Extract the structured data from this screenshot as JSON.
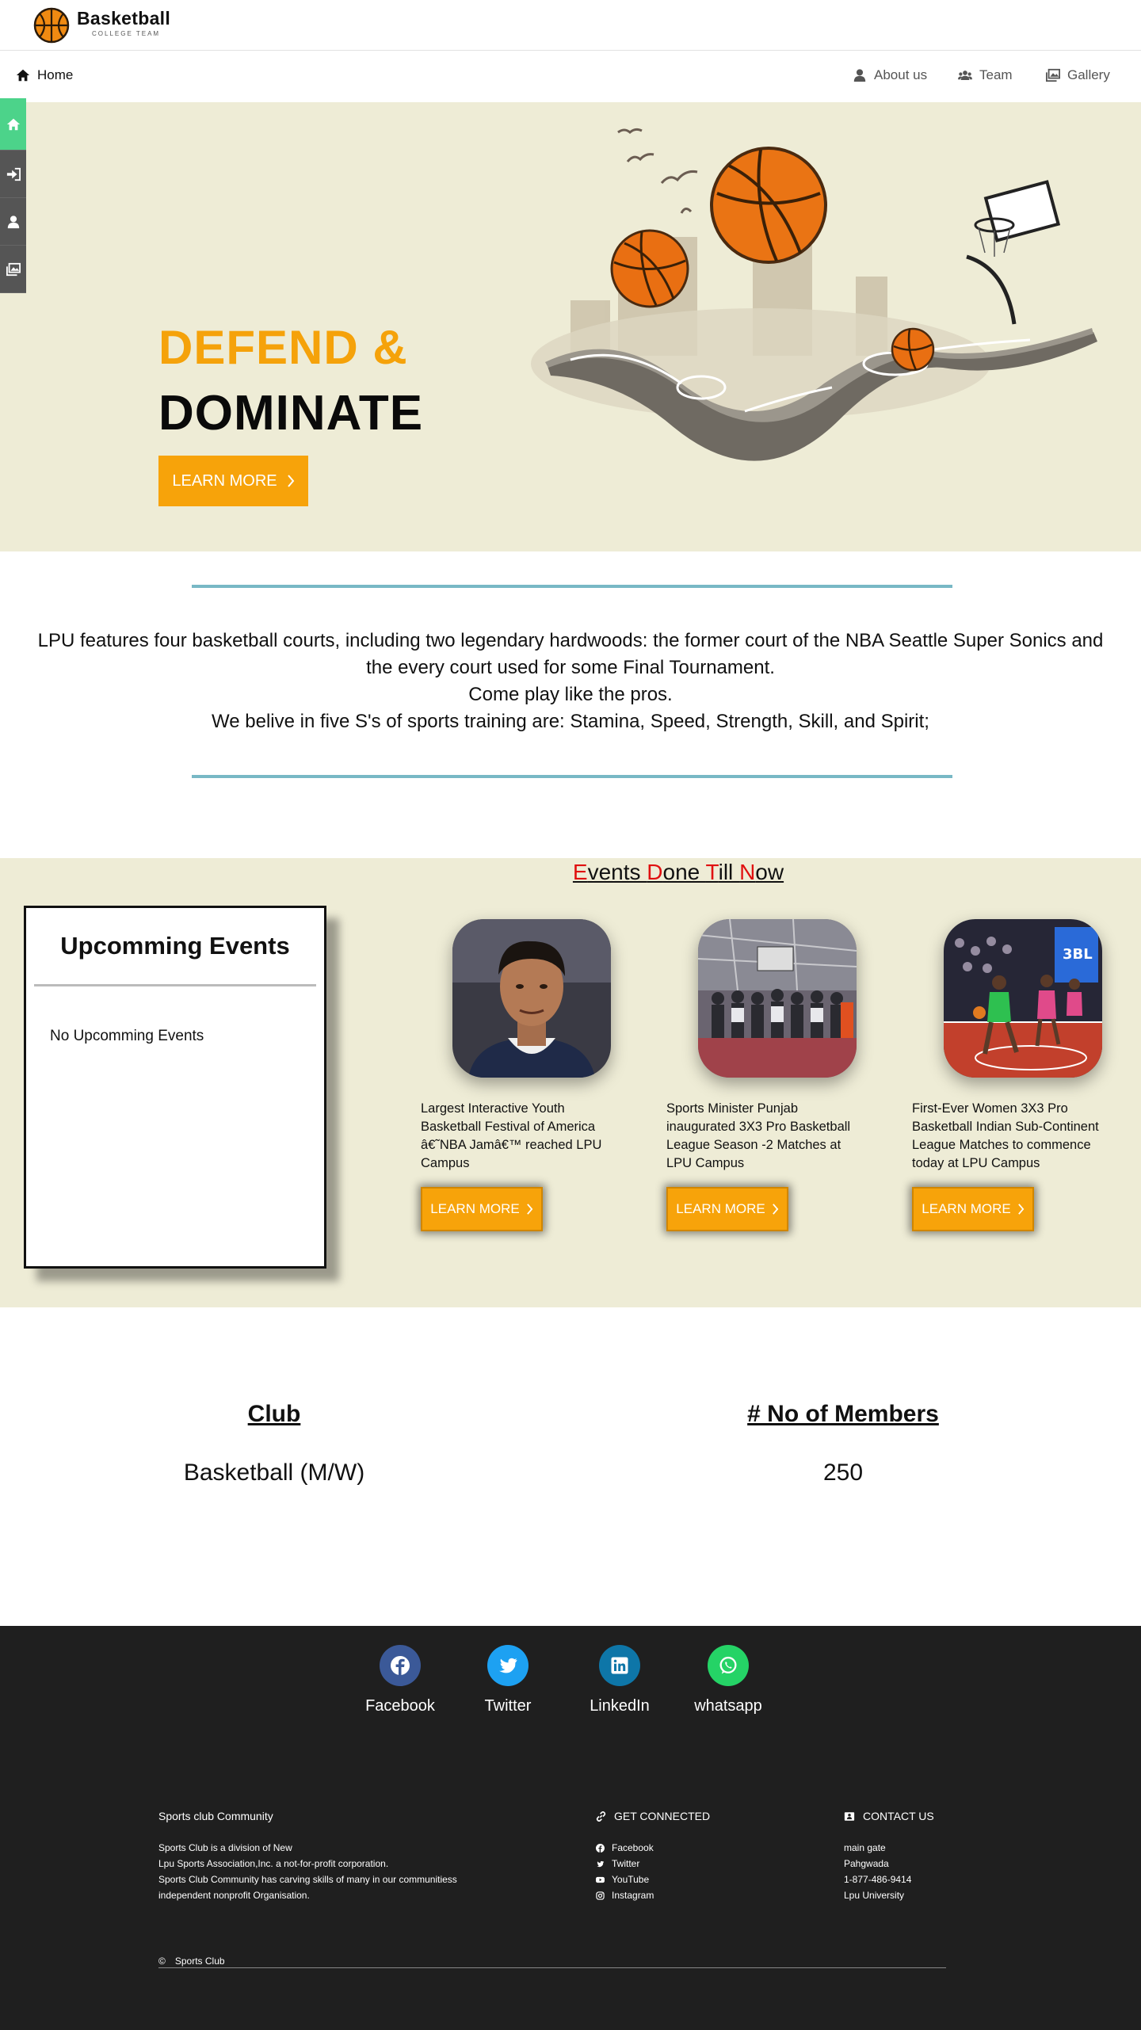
{
  "brand": {
    "title": "Basketball",
    "subtitle": "COLLEGE TEAM"
  },
  "nav": {
    "home": "Home",
    "about": "About us",
    "team": "Team",
    "gallery": "Gallery"
  },
  "hero": {
    "line1": "DEFEND &",
    "line2": "DOMINATE",
    "button": "LEARN MORE",
    "colors": {
      "accent": "#f7a30a",
      "background": "#eeecd6"
    }
  },
  "sidebar": {
    "icons": [
      "home-icon",
      "sign-in-icon",
      "user-icon",
      "gallery-icon"
    ],
    "active_color": "#4cd38a"
  },
  "about": {
    "line1": "LPU features four basketball courts, including two legendary hardwoods: the former court of the NBA Seattle Super Sonics and the every court used for some Final Tournament.",
    "line2": "Come play like the pros.",
    "line3": "We belive in five S's of sports training are: Stamina, Speed, Strength, Skill, and Spirit;"
  },
  "events": {
    "title_parts": [
      {
        "first": "E",
        "rest": "vents "
      },
      {
        "first": "D",
        "rest": "one "
      },
      {
        "first": "T",
        "rest": "ill "
      },
      {
        "first": "N",
        "rest": "ow"
      }
    ],
    "upcoming_title": "Upcomming Events",
    "upcoming_empty": "No Upcomming Events",
    "cards": [
      {
        "text": "Largest Interactive Youth Basketball Festival of America â€˜NBA Jamâ€™ reached LPU Campus",
        "button": "LEARN MORE"
      },
      {
        "text": "Sports Minister Punjab inaugurated 3X3 Pro Basketball League Season -2 Matches at LPU Campus",
        "button": "LEARN MORE"
      },
      {
        "text": "First-Ever Women 3X3 Pro Basketball Indian Sub-Continent League Matches to commence today at LPU Campus",
        "button": "LEARN MORE"
      }
    ]
  },
  "club": {
    "headers": [
      "Club",
      "# No of Members"
    ],
    "row": [
      "Basketball (M/W)",
      "250"
    ]
  },
  "footer": {
    "social": [
      {
        "label": "Facebook",
        "icon": "facebook-icon",
        "color": "#3b5998"
      },
      {
        "label": "Twitter",
        "icon": "twitter-icon",
        "color": "#1da1f2"
      },
      {
        "label": "LinkedIn",
        "icon": "linkedin-icon",
        "color": "#0e76a8"
      },
      {
        "label": "whatsapp",
        "icon": "whatsapp-icon",
        "color": "#25d366"
      }
    ],
    "about_title": "Sports club Community",
    "about_lines": [
      "Sports Club is a division of New",
      "Lpu Sports Association,Inc. a not-for-profit corporation.",
      "Sports Club Community has carving skills of many in our communitiess",
      "independent nonprofit Organisation."
    ],
    "connect_title": "GET CONNECTED",
    "connect_links": [
      "Facebook",
      "Twitter",
      "YouTube",
      "Instagram"
    ],
    "contact_title": "CONTACT US",
    "contact_lines": [
      "main gate",
      "Pahgwada",
      "1-877-486-9414",
      "Lpu University"
    ],
    "copyright_symbol": "©",
    "copyright_text": "Sports Club"
  }
}
